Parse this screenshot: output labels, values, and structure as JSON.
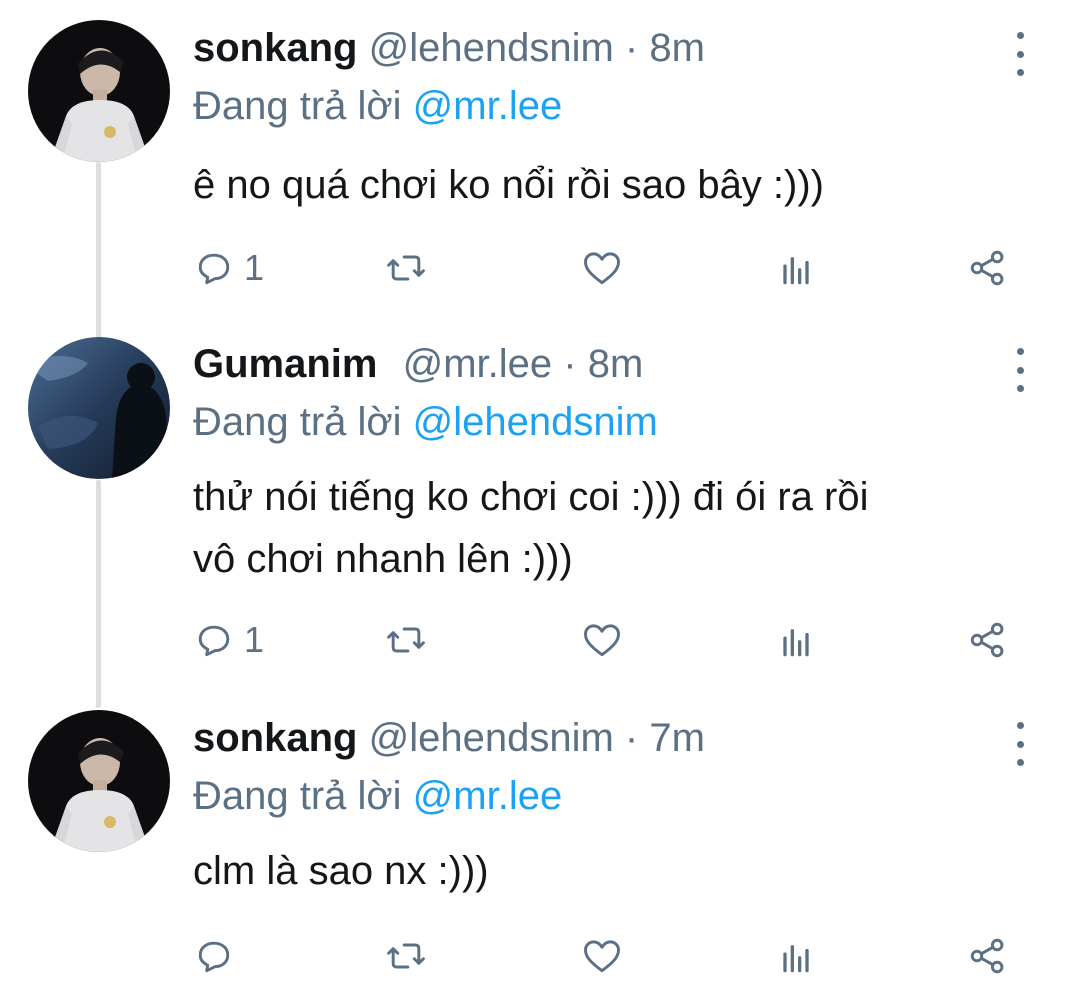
{
  "tweets": [
    {
      "name": "sonkang",
      "handle": "@lehendsnim",
      "dot": "·",
      "time": "8m",
      "replying_prefix": "Đang trả lời",
      "replying_to": "@mr.lee",
      "lines": [
        "ê no quá chơi ko nổi rồi sao bây :)))"
      ],
      "reply_count": "1",
      "avatar": "boy-white-tshirt"
    },
    {
      "name": "Gumanim",
      "handle": "@mr.lee",
      "dot": "·",
      "time": "8m",
      "replying_prefix": "Đang trả lời",
      "replying_to": "@lehendsnim",
      "lines": [
        "thử nói tiếng ko chơi coi :))) đi ói ra rồi",
        "vô chơi nhanh lên :)))"
      ],
      "reply_count": "1",
      "avatar": "dark-blue-scene"
    },
    {
      "name": "sonkang",
      "handle": "@lehendsnim",
      "dot": "·",
      "time": "7m",
      "replying_prefix": "Đang trả lời",
      "replying_to": "@mr.lee",
      "lines": [
        "clm là sao nx :)))"
      ],
      "reply_count": "",
      "avatar": "boy-white-tshirt"
    }
  ],
  "icons": {
    "reply": "reply-icon",
    "retweet": "retweet-icon",
    "like": "like-icon",
    "analytics": "analytics-icon",
    "share": "share-icon",
    "more": "more-vertical-icon"
  },
  "colors": {
    "name": "#14171a",
    "secondary": "#5b7083",
    "mention": "#1da1f2",
    "thread_line": "#dcdfe2"
  }
}
